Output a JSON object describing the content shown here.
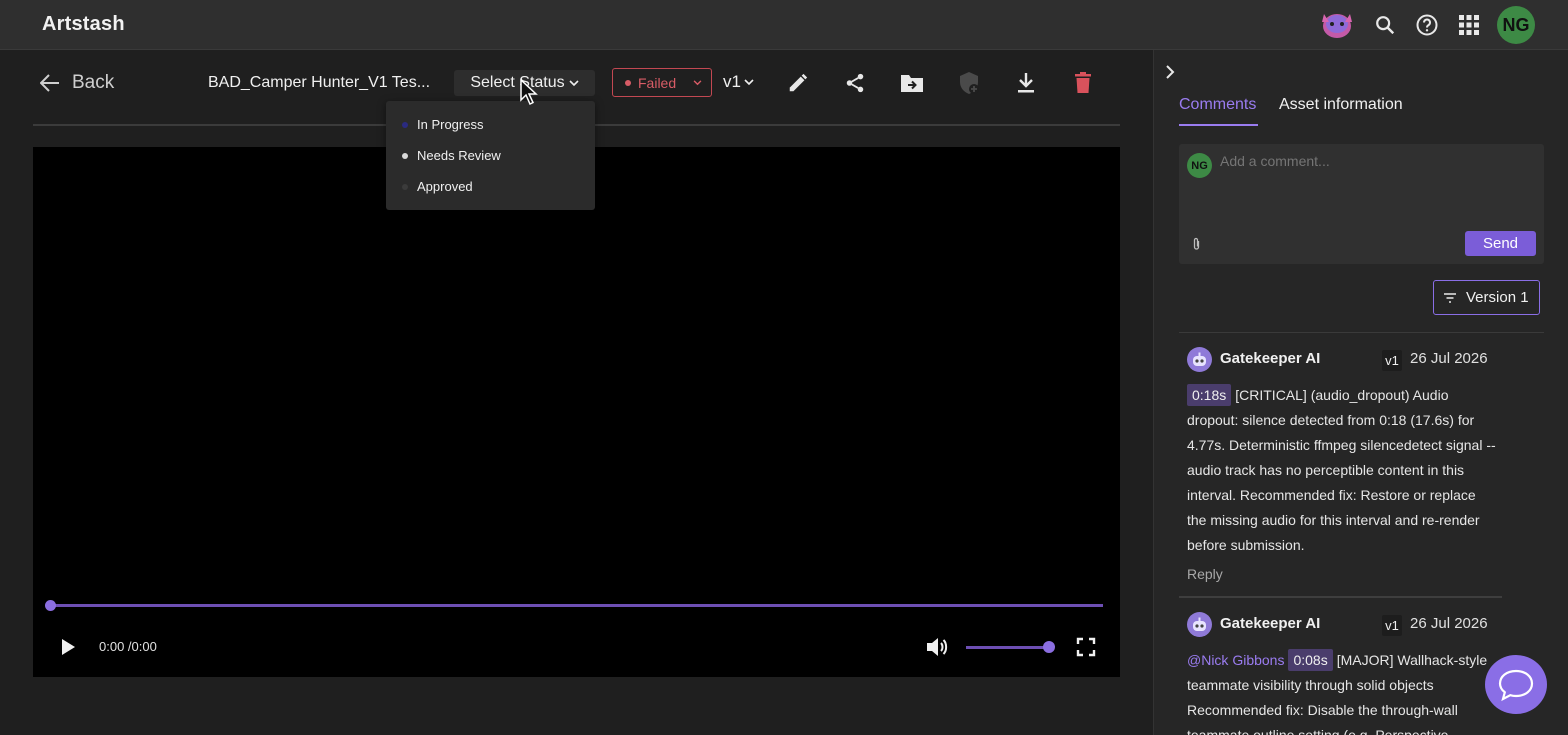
{
  "app": {
    "title": "Artstash"
  },
  "topbar": {
    "user_initials": "NG",
    "icons": [
      "mascot-icon",
      "search-icon",
      "help-icon",
      "apps-grid-icon"
    ]
  },
  "toolbar": {
    "back_label": "Back",
    "asset_title": "BAD_Camper Hunter_V1 Tes...",
    "select_status_label": "Select Status",
    "status_badge": "Failed",
    "version": "v1",
    "tool_icons": [
      "edit-icon",
      "share-icon",
      "move-to-folder-icon",
      "shield-add-icon",
      "download-icon",
      "delete-icon"
    ]
  },
  "status_dropdown": {
    "options": [
      {
        "label": "In Progress",
        "color": "#2a2a80"
      },
      {
        "label": "Needs Review",
        "color": "#d9d9d9"
      },
      {
        "label": "Approved",
        "color": "#3b3b3b"
      }
    ]
  },
  "player": {
    "time": "0:00 /0:00",
    "progress": 0,
    "volume": 1
  },
  "panel": {
    "tabs": [
      "Comments",
      "Asset information"
    ],
    "active_tab": "Comments",
    "comment_input": {
      "avatar": "NG",
      "placeholder": "Add a comment...",
      "send_label": "Send"
    },
    "version_filter": "Version 1",
    "comments": [
      {
        "author": "Gatekeeper AI",
        "version": "v1",
        "date": "26 Jul 2026",
        "mention": "",
        "timestamp": "0:18s",
        "text": "[CRITICAL] (audio_dropout) Audio dropout: silence detected from 0:18 (17.6s) for 4.77s. Deterministic ffmpeg silencedetect signal -- audio track has no perceptible content in this interval. Recommended fix: Restore or replace the missing audio for this interval and re-render before submission.",
        "reply_label": "Reply"
      },
      {
        "author": "Gatekeeper AI",
        "version": "v1",
        "date": "26 Jul 2026",
        "mention": "@Nick Gibbons",
        "timestamp": "0:08s",
        "text": "[MAJOR] Wallhack-style teammate visibility through solid objects Recommended fix: Disable the through-wall teammate outline setting (e.g. Perspective",
        "reply_label": ""
      }
    ]
  },
  "colors": {
    "accent": "#9a7cf0",
    "danger": "#d85c66",
    "background": "#1f1f1f"
  }
}
